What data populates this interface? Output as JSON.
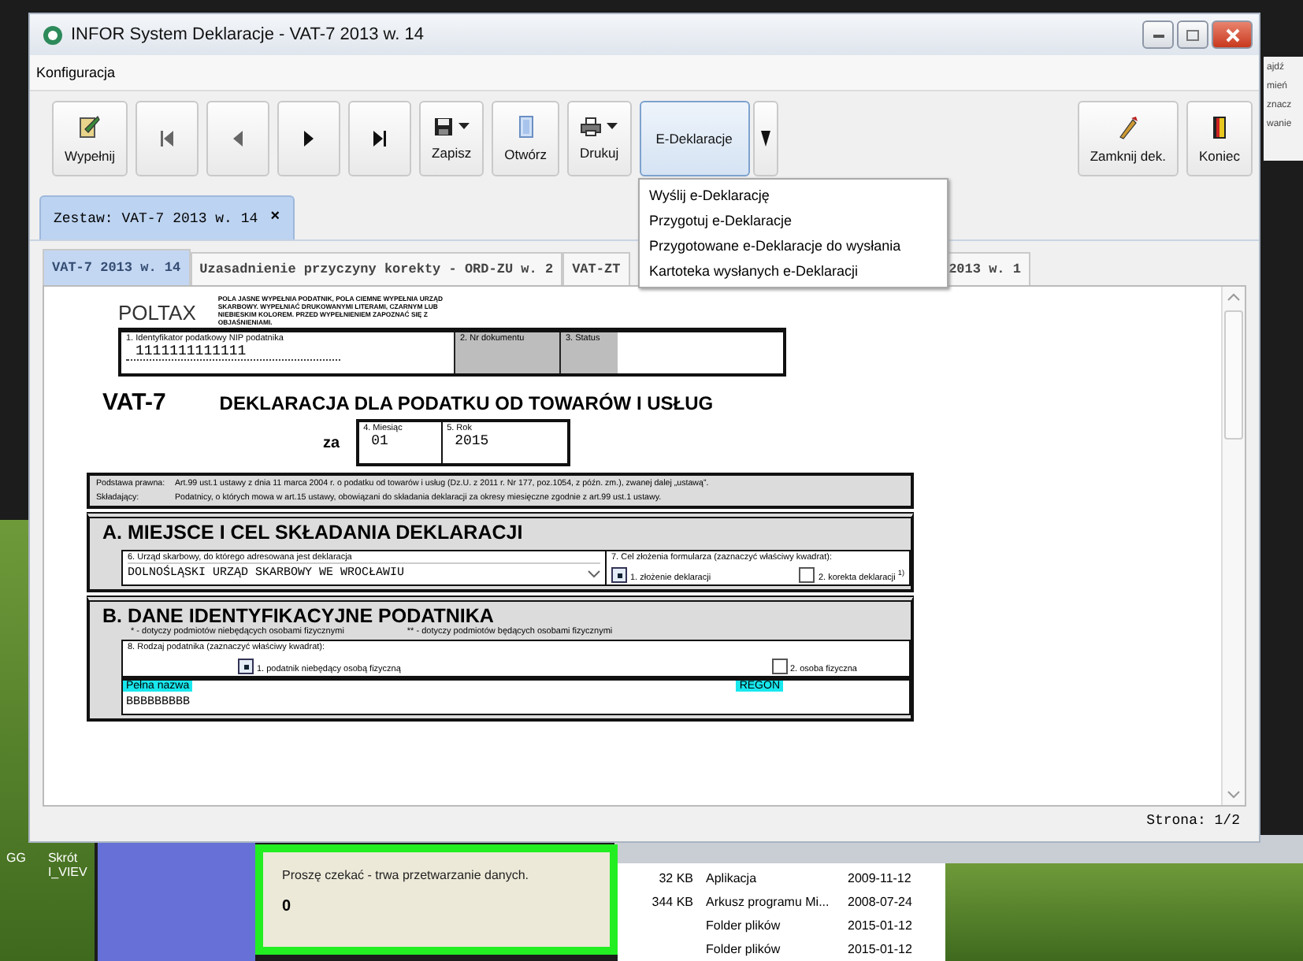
{
  "window": {
    "title": "INFOR System Deklaracje - VAT-7 2013 w. 14",
    "menu": [
      "Konfiguracja"
    ],
    "toolbar": [
      {
        "kind": "fill",
        "label": "Wypełnij",
        "has_menu": false,
        "pressed": false
      },
      {
        "kind": "first",
        "has_menu": false,
        "pressed": false
      },
      {
        "kind": "prev",
        "has_menu": false,
        "pressed": false
      },
      {
        "kind": "next",
        "has_menu": false,
        "pressed": false
      },
      {
        "kind": "last",
        "has_menu": false,
        "pressed": false
      },
      {
        "kind": "save",
        "label": "Zapisz",
        "has_menu": true,
        "pressed": false
      },
      {
        "kind": "open",
        "label": "Otwórz",
        "has_menu": false,
        "pressed": false
      },
      {
        "kind": "print",
        "label": "Drukuj",
        "has_menu": true,
        "pressed": false
      },
      {
        "kind": "edecl",
        "label": "E-Deklaracje",
        "has_menu": true,
        "pressed": true
      },
      {
        "kind": "close",
        "label": "Zamknij dek.",
        "has_menu": false,
        "pressed": false
      },
      {
        "kind": "exit",
        "label": "Koniec",
        "has_menu": false,
        "pressed": false
      }
    ],
    "dropdown": [
      "Wyślij e-Deklarację",
      "Przygotuj e-Deklaracje",
      "Przygotowane e-Deklaracje do wysłania",
      "Kartoteka wysłanych e-Deklaracji"
    ],
    "set_tab": {
      "label": "Zestaw: VAT-7 2013 w. 14",
      "close": "×"
    },
    "tabs": [
      {
        "label": "VAT-7 2013 w. 14",
        "selected": true
      },
      {
        "label": "Uzasadnienie przyczyny korekty - ORD-ZU w. 2",
        "selected": false
      },
      {
        "label": "VAT-ZT",
        "selected": false
      },
      {
        "label": "2013 w. 1",
        "selected": false
      }
    ],
    "form": {
      "logo": "POLTAX",
      "notice": "POLA JASNE WYPEŁNIA PODATNIK, POLA CIEMNE WYPEŁNIA URZĄD SKARBOWY. WYPEŁNIAĆ DRUKOWANYMI LITERAMI, CZARNYM LUB NIEBIESKIM KOLOREM. PRZED WYPEŁNIENIEM ZAPOZNAĆ SIĘ Z OBJAŚNIENIAMI.",
      "top_fields": [
        {
          "label": "1. Identyfikator podatkowy NIP podatnika",
          "value": "1111111111111",
          "shaded": false
        },
        {
          "label": "2. Nr dokumentu",
          "shaded": true
        },
        {
          "label": "3. Status",
          "shaded": true
        }
      ],
      "code": "VAT-7",
      "title": "DEKLARACJA DLA PODATKU OD TOWARÓW I USŁUG",
      "period": {
        "prefix": "za",
        "fields": [
          {
            "label": "4. Miesiąc",
            "value": "01"
          },
          {
            "label": "5. Rok",
            "value": "2015"
          }
        ]
      },
      "basis": [
        {
          "label": "Podstawa prawna:",
          "text": "Art.99 ust.1 ustawy z dnia 11 marca 2004 r. o podatku od towarów i usług (Dz.U. z 2011 r. Nr 177, poz.1054, z późn. zm.), zwanej dalej „ustawą”."
        },
        {
          "label": "Składający:",
          "text": "Podatnicy, o których mowa w art.15 ustawy, obowiązani do składania deklaracji za okresy miesięczne zgodnie z art.99 ust.1 ustawy."
        }
      ],
      "section_a": {
        "title": "A. MIEJSCE I CEL SKŁADANIA DEKLARACJI",
        "office_label": "6. Urząd skarbowy, do którego adresowana jest deklaracja",
        "office_value": "DOLNOŚLĄSKI URZĄD SKARBOWY WE WROCŁAWIU",
        "purpose_label": "7. Cel złożenia formularza (zaznaczyć właściwy kwadrat):",
        "options": [
          {
            "label": "1. złożenie deklaracji",
            "checked": true
          },
          {
            "label": "2. korekta deklaracji $^{1)}$",
            "checked": false
          }
        ]
      },
      "section_b": {
        "title": "B. DANE IDENTYFIKACYJNE PODATNIKA",
        "notes": [
          "* - dotyczy podmiotów niebędących osobami fizycznymi",
          "** - dotyczy podmiotów będących osobami fizycznymi"
        ],
        "type_label": "8. Rodzaj podatnika (zaznaczyć właściwy kwadrat):",
        "options": [
          {
            "label": "1. podatnik niebędący osobą fizyczną",
            "checked": true
          },
          {
            "label": "2. osoba fizyczna",
            "checked": false
          }
        ],
        "name_tags": [
          "Pełna nazwa",
          "REGON"
        ],
        "name_value": "BBBBBBBBB"
      }
    },
    "status": "Strona: 1/2"
  },
  "side_panel": [
    "ajdź",
    "mień",
    "znacz",
    "wanie"
  ],
  "desktop_icons": [
    {
      "lines": [
        "GG"
      ]
    },
    {
      "lines": [
        "Skrót",
        "I_VIEV"
      ]
    }
  ],
  "dialog": {
    "message": "Proszę czekać -  trwa przetwarzanie danych.",
    "counter": "0"
  },
  "file_list": [
    {
      "size": "32 KB",
      "type": "Aplikacja",
      "date": "2009-11-12"
    },
    {
      "size": "344 KB",
      "type": "Arkusz programu Mi...",
      "date": "2008-07-24"
    },
    {
      "type": "Folder plików",
      "date": "2015-01-12"
    },
    {
      "type": "Folder plików",
      "date": "2015-01-12"
    }
  ]
}
